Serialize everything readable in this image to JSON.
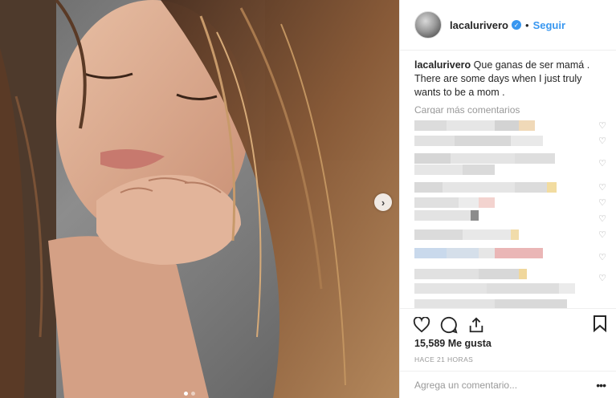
{
  "post": {
    "username": "lacalurivero",
    "follow_label": "Seguir",
    "separator": "•",
    "caption_text": "Que ganas de ser mamá . There are some days when I just truly wants to be a mom .",
    "load_more_label": "Cargar más comentarios",
    "likes": "15,589 Me gusta",
    "timestamp": "HACE 21 HORAS",
    "comment_placeholder": "Agrega un comentario...",
    "more_label": "•••",
    "next_arrow": "›"
  },
  "icons": [
    "heart-icon",
    "comment-icon",
    "share-icon",
    "bookmark-icon",
    "verified-icon"
  ],
  "colors": {
    "accent": "#3897f0",
    "muted": "#999999",
    "border": "#efefef"
  }
}
